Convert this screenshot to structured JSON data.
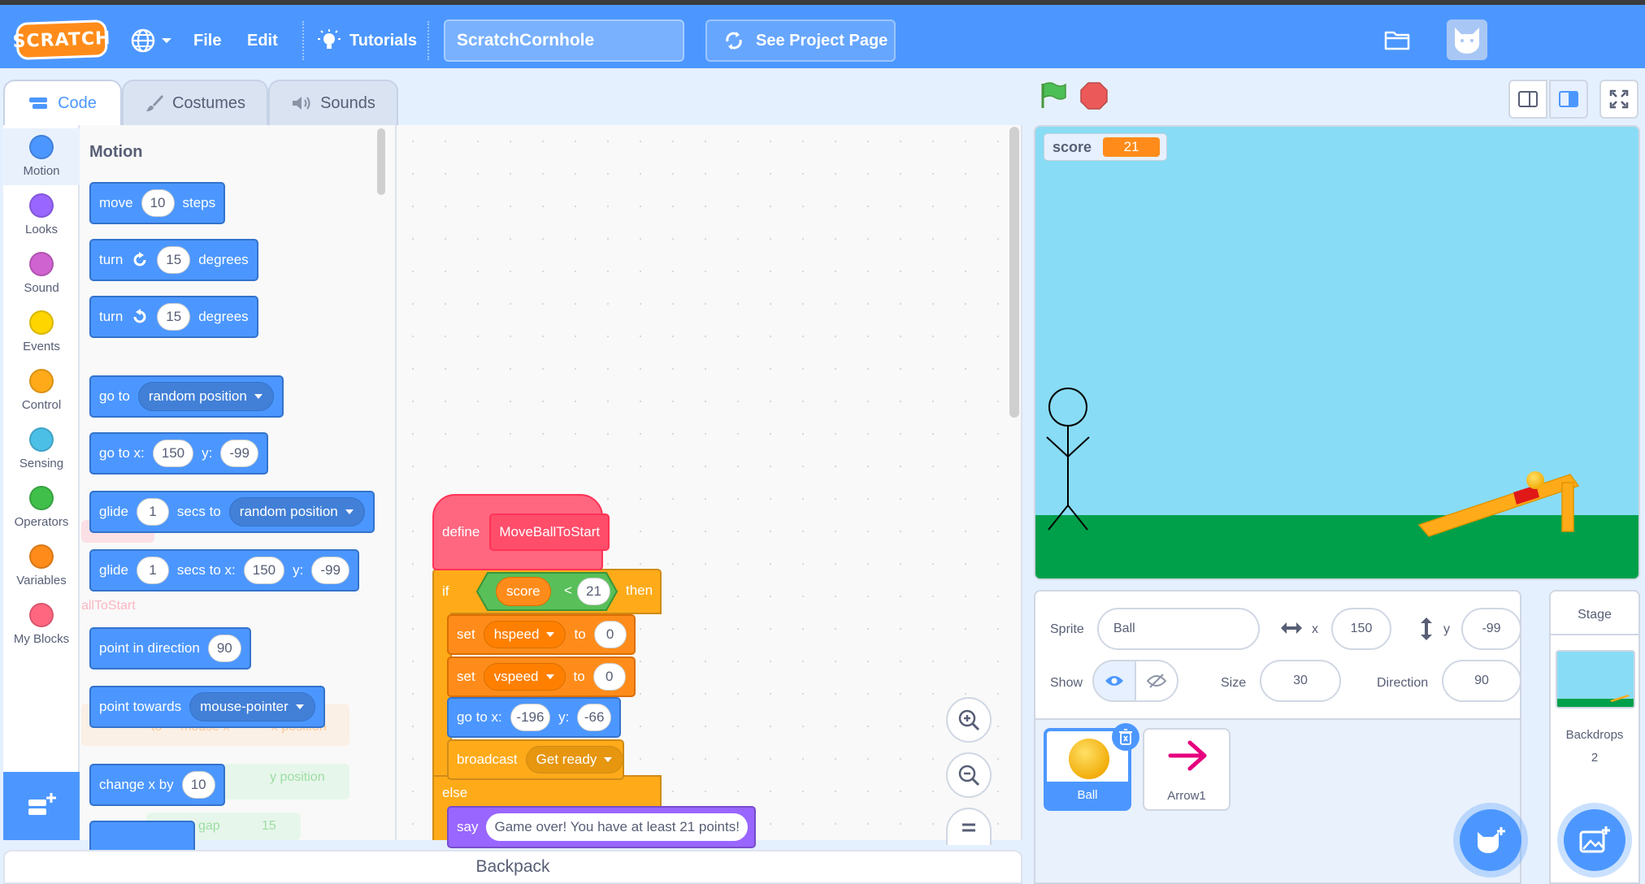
{
  "menu": {
    "logo": "SCRATCH",
    "file": "File",
    "edit": "Edit",
    "tutorials": "Tutorials",
    "project_title": "ScratchCornhole",
    "see_project": "See Project Page"
  },
  "tabs": [
    {
      "label": "Code"
    },
    {
      "label": "Costumes"
    },
    {
      "label": "Sounds"
    }
  ],
  "categories": [
    {
      "label": "Motion",
      "color": "#4c97ff"
    },
    {
      "label": "Looks",
      "color": "#9966ff"
    },
    {
      "label": "Sound",
      "color": "#cf63cf"
    },
    {
      "label": "Events",
      "color": "#ffd500"
    },
    {
      "label": "Control",
      "color": "#ffab19"
    },
    {
      "label": "Sensing",
      "color": "#4cbfe6"
    },
    {
      "label": "Operators",
      "color": "#40bf4a"
    },
    {
      "label": "Variables",
      "color": "#ff8c1a"
    },
    {
      "label": "My Blocks",
      "color": "#ff6680"
    }
  ],
  "palette": {
    "title": "Motion",
    "move": {
      "a": "move",
      "n": "10",
      "b": "steps"
    },
    "turn_cw": {
      "a": "turn",
      "n": "15",
      "b": "degrees"
    },
    "turn_ccw": {
      "a": "turn",
      "n": "15",
      "b": "degrees"
    },
    "goto": {
      "a": "go to",
      "opt": "random position"
    },
    "gotoxy": {
      "a": "go to x:",
      "x": "150",
      "yl": "y:",
      "y": "-99"
    },
    "glide_to": {
      "a": "glide",
      "n": "1",
      "b": "secs to",
      "opt": "random position"
    },
    "glide_xy": {
      "a": "glide",
      "n": "1",
      "b": "secs to x:",
      "x": "150",
      "yl": "y:",
      "y": "-99"
    },
    "point_dir": {
      "a": "point in direction",
      "n": "90"
    },
    "point_towards": {
      "a": "point towards",
      "opt": "mouse-pointer"
    },
    "change_x": {
      "a": "change x by",
      "n": "10"
    },
    "ghost_label": "allToStart",
    "ghost_x": "x position",
    "ghost_y": "y position",
    "ghost_gap": "gap",
    "ghost_15": "15",
    "ghost_to": "to",
    "ghost_mouse": "mouse x"
  },
  "script": {
    "define": "define",
    "proc_name": "MoveBallToStart",
    "if": "if",
    "var_score": "score",
    "op": "<",
    "val_21": "21",
    "then": "then",
    "set1": {
      "a": "set",
      "var": "hspeed",
      "b": "to",
      "v": "0"
    },
    "set2": {
      "a": "set",
      "var": "vspeed",
      "b": "to",
      "v": "0"
    },
    "goto": {
      "a": "go to x:",
      "x": "-196",
      "yl": "y:",
      "y": "-66"
    },
    "broadcast": {
      "a": "broadcast",
      "msg": "Get ready"
    },
    "else": "else",
    "say": {
      "a": "say",
      "text": "Game over! You have at least 21 points!"
    }
  },
  "backpack": "Backpack",
  "stage": {
    "monitor_label": "score",
    "monitor_value": "21"
  },
  "sprite_info": {
    "sprite_label": "Sprite",
    "sprite_name": "Ball",
    "x_label": "x",
    "x": "150",
    "y_label": "y",
    "y": "-99",
    "show_label": "Show",
    "size_label": "Size",
    "size": "30",
    "direction_label": "Direction",
    "direction": "90"
  },
  "sprites": [
    {
      "name": "Ball"
    },
    {
      "name": "Arrow1"
    }
  ],
  "stage_pane": {
    "title": "Stage",
    "backdrops_label": "Backdrops",
    "backdrops_count": "2"
  }
}
